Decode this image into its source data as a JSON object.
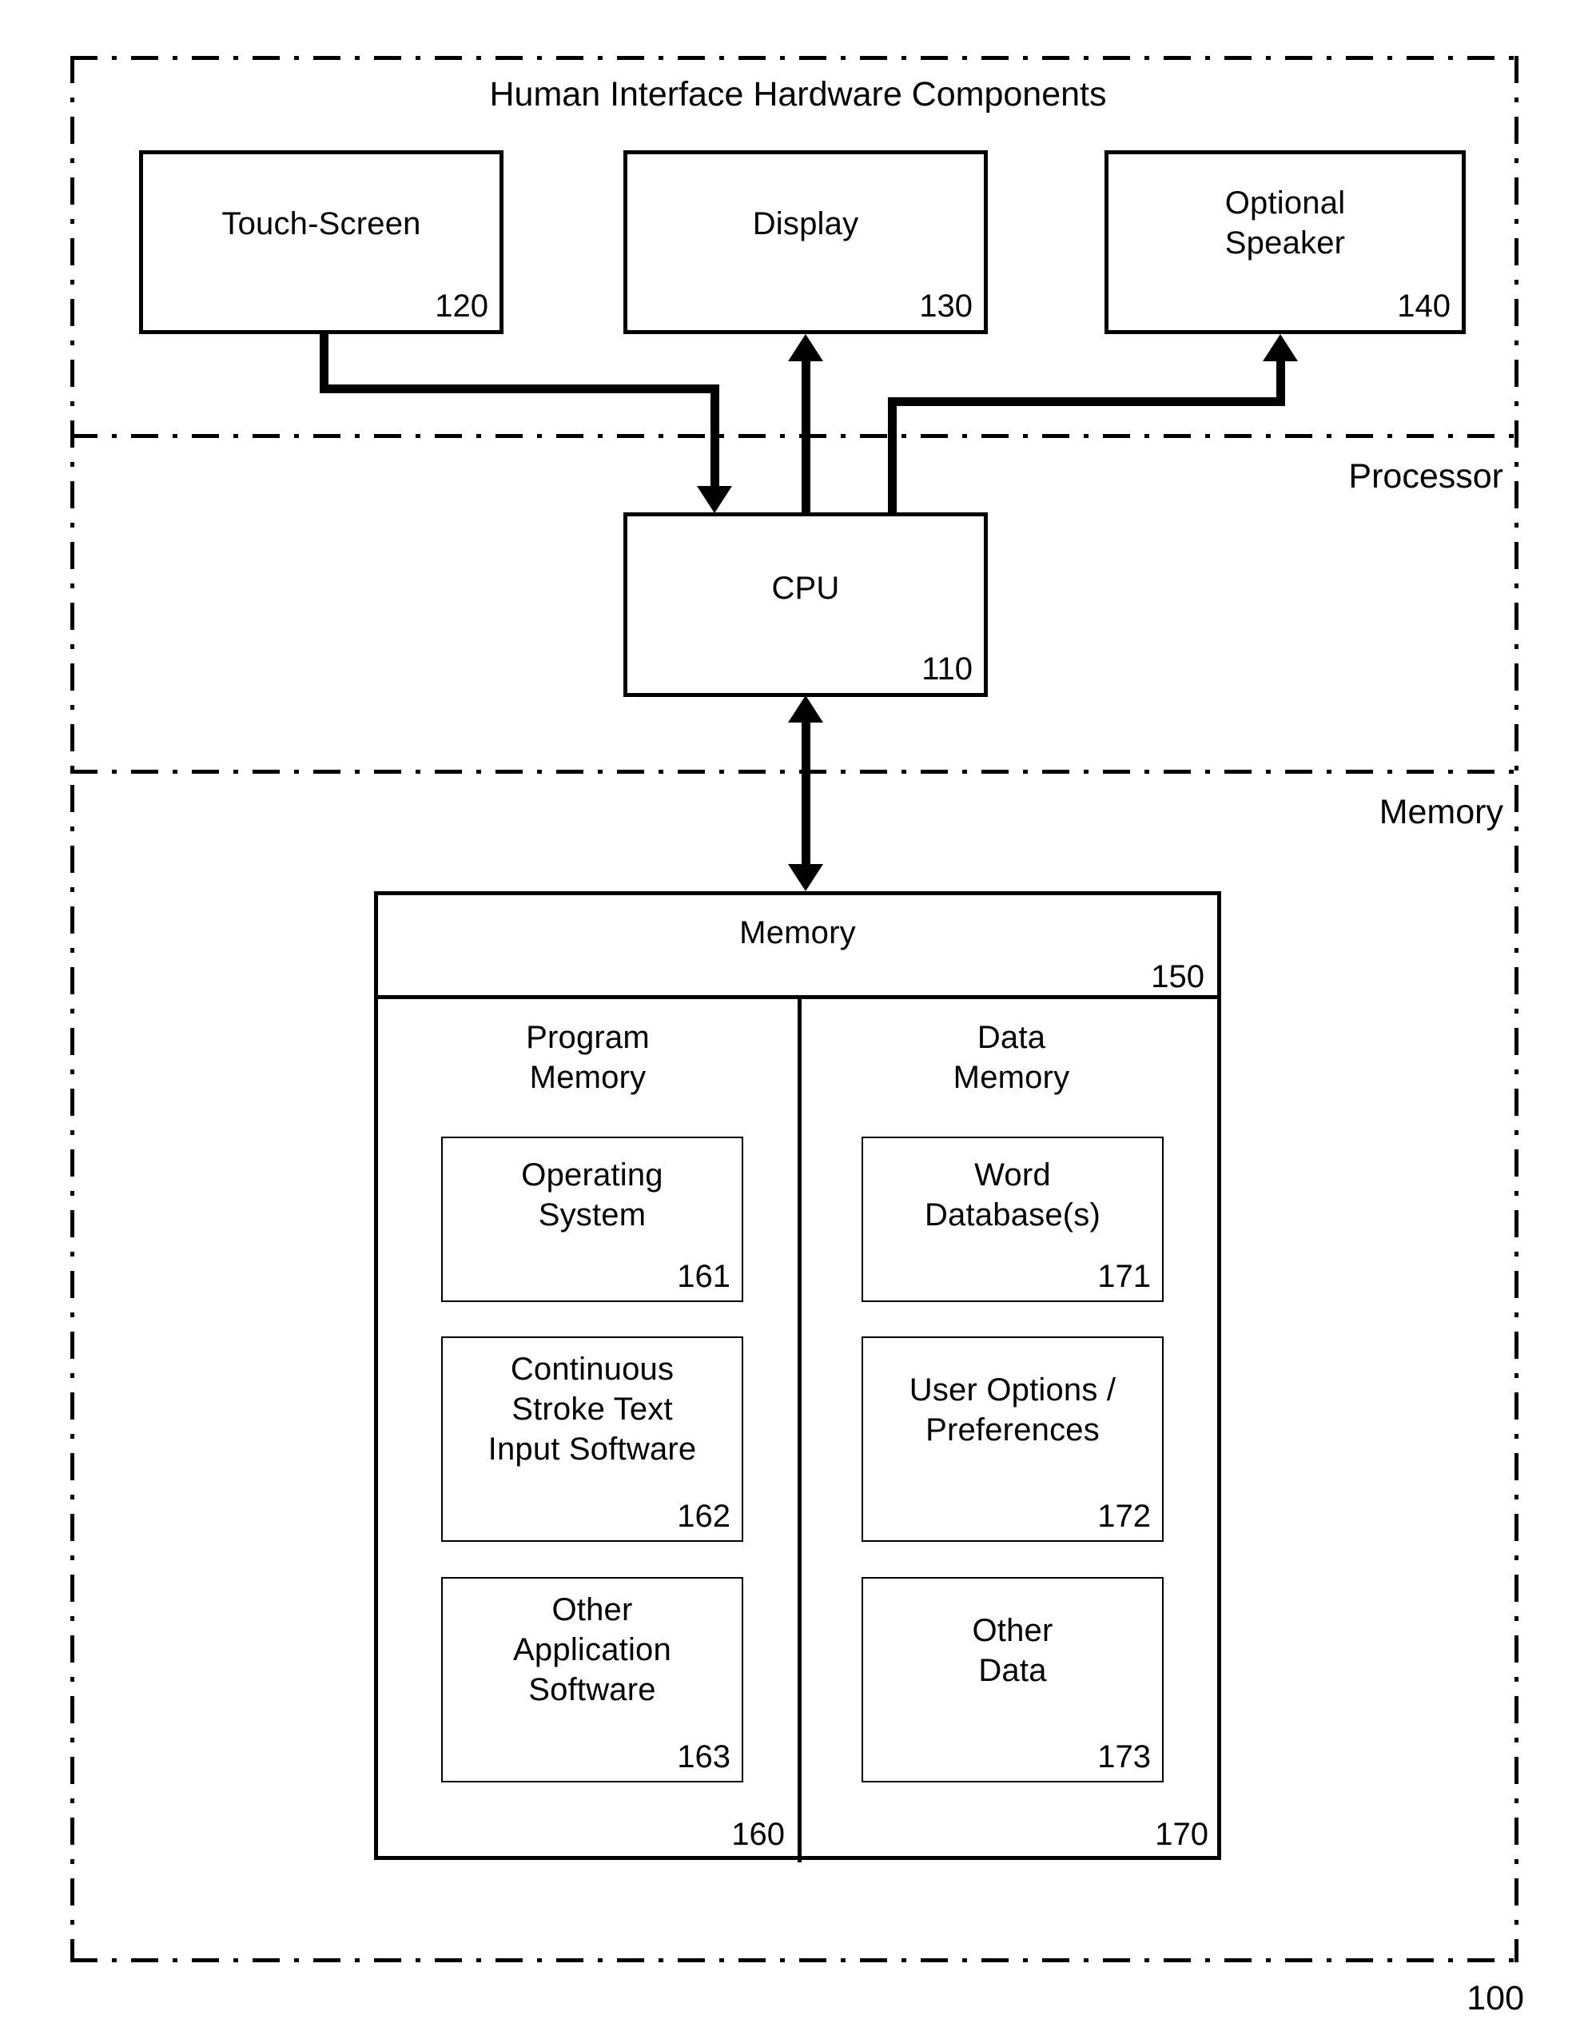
{
  "figure": {
    "outer_ref": "100",
    "regions": [
      {
        "id": "human-interface",
        "label": "Human Interface Hardware Components"
      },
      {
        "id": "processor",
        "label": "Processor"
      },
      {
        "id": "memory",
        "label": "Memory"
      }
    ]
  },
  "blocks": {
    "touch_screen": {
      "label": "Touch-Screen",
      "ref": "120"
    },
    "display": {
      "label": "Display",
      "ref": "130"
    },
    "speaker": {
      "label_line1": "Optional",
      "label_line2": "Speaker",
      "ref": "140"
    },
    "cpu": {
      "label": "CPU",
      "ref": "110"
    },
    "memory": {
      "label": "Memory",
      "ref": "150"
    },
    "program_memory": {
      "label_line1": "Program",
      "label_line2": "Memory",
      "ref": "160"
    },
    "data_memory": {
      "label_line1": "Data",
      "label_line2": "Memory",
      "ref": "170"
    },
    "operating_system": {
      "label_line1": "Operating",
      "label_line2": "System",
      "ref": "161"
    },
    "cst_input_software": {
      "label_line1": "Continuous",
      "label_line2": "Stroke Text",
      "label_line3": "Input Software",
      "ref": "162"
    },
    "other_application_software": {
      "label_line1": "Other",
      "label_line2": "Application",
      "label_line3": "Software",
      "ref": "163"
    },
    "word_database": {
      "label_line1": "Word",
      "label_line2": "Database(s)",
      "ref": "171"
    },
    "user_options": {
      "label_line1": "User Options /",
      "label_line2": "Preferences",
      "ref": "172"
    },
    "other_data": {
      "label_line1": "Other",
      "label_line2": "Data",
      "ref": "173"
    }
  },
  "connections": [
    {
      "id": "touchscreen-to-cpu",
      "from": "Touch-Screen",
      "to": "CPU",
      "direction": "one-way"
    },
    {
      "id": "cpu-to-display",
      "from": "CPU",
      "to": "Display",
      "direction": "one-way"
    },
    {
      "id": "cpu-to-speaker",
      "from": "CPU",
      "to": "Optional Speaker",
      "direction": "one-way"
    },
    {
      "id": "cpu-to-memory",
      "from": "CPU",
      "to": "Memory",
      "direction": "two-way"
    }
  ],
  "colors": {
    "stroke": "#000000",
    "background": "#ffffff"
  }
}
